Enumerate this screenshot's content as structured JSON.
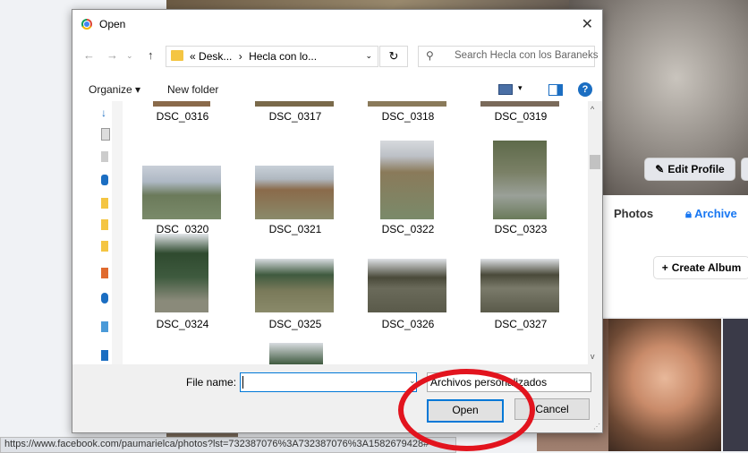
{
  "background": {
    "edit_profile": "Edit Profile",
    "tabs": {
      "photos": "Photos",
      "archive": "Archive"
    },
    "create_album": "Create Album",
    "status_url": "https://www.facebook.com/paumarielca/photos?lst=732387076%3A732387076%3A1582679428#"
  },
  "dialog": {
    "title": "Open",
    "path_prefix": "«",
    "path_seg1": "Desk...",
    "path_sep": "›",
    "path_seg2": "Hecla con lo...",
    "search_placeholder": "Search Hecla con los Baraneks",
    "organize": "Organize ▾",
    "new_folder": "New folder",
    "files": [
      {
        "name": "DSC_0316"
      },
      {
        "name": "DSC_0317"
      },
      {
        "name": "DSC_0318"
      },
      {
        "name": "DSC_0319"
      },
      {
        "name": "DSC_0320"
      },
      {
        "name": "DSC_0321"
      },
      {
        "name": "DSC_0322"
      },
      {
        "name": "DSC_0323"
      },
      {
        "name": "DSC_0324"
      },
      {
        "name": "DSC_0325"
      },
      {
        "name": "DSC_0326"
      },
      {
        "name": "DSC_0327"
      }
    ],
    "file_name_label": "File name:",
    "file_name_value": "",
    "filter_value": "Archivos personalizados",
    "open_button": "Open",
    "cancel_button": "Cancel"
  },
  "colors": {
    "annotation": "#e2141e",
    "accent": "#0078d7"
  }
}
